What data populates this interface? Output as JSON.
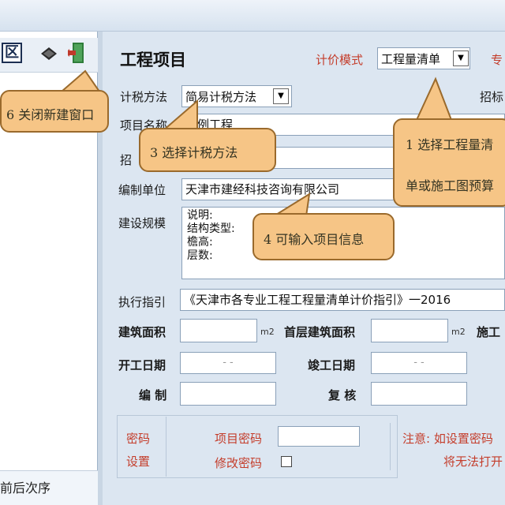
{
  "toolbar": {
    "close_symbol": "区"
  },
  "left_footer": "前后次序",
  "header": {
    "title": "工程项目",
    "pricing_mode_label": "计价模式",
    "pricing_mode_value": "工程量清单",
    "pricing_mode_dropdown": "▼",
    "right_clipped_text": "专",
    "right_clipped_text2": "招标"
  },
  "form": {
    "tax_method_label": "计税方法",
    "tax_method_value": "简易计税方法",
    "tax_method_dropdown": "▼",
    "project_name_label": "项目名称",
    "project_name_value": "示例工程",
    "bid_label": "招",
    "org_label": "编制单位",
    "org_value": "天津市建经科技咨询有限公司",
    "scale_label": "建设规模",
    "scale_lines": [
      "说明:",
      "结构类型:",
      "檐高:",
      "层数:"
    ],
    "guide_label": "执行指引",
    "guide_value": "《天津市各专业工程工程量清单计价指引》一2016",
    "area_label": "建筑面积",
    "area_unit": "m2",
    "first_floor_area_label": "首层建筑面积",
    "first_floor_unit": "m2",
    "construction_clipped": "施工",
    "start_date_label": "开工日期",
    "start_date_placeholder": "-   -",
    "end_date_label": "竣工日期",
    "end_date_placeholder": "-   -",
    "compiler_label": "编 制",
    "reviewer_label": "复 核",
    "password_group_label_1": "密码",
    "password_group_label_2": "设置",
    "project_password_label": "项目密码",
    "change_password_label": "修改密码",
    "note_line_1": "注意: 如设置密码",
    "note_line_2": "将无法打开"
  },
  "callouts": {
    "c1_line1": "1 选择工程量清",
    "c1_line2": "单或施工图预算",
    "c3": "3 选择计税方法",
    "c4": "4 可输入项目信息",
    "c6": "6 关闭新建窗口"
  },
  "colors": {
    "callout_fill": "#f6c586",
    "callout_border": "#9a6a2c",
    "accent_red": "#c43d2b",
    "panel_bg": "#dce6f1"
  }
}
